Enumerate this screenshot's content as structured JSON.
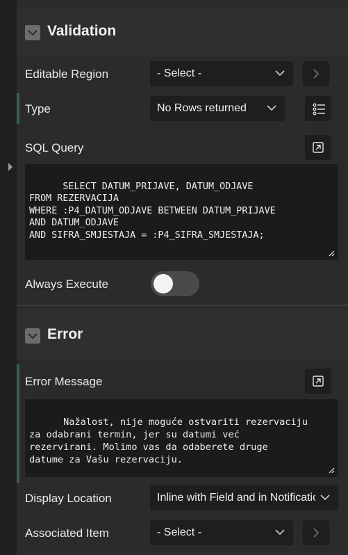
{
  "validation": {
    "title": "Validation",
    "editable_region": {
      "label": "Editable Region",
      "value": "- Select -"
    },
    "type": {
      "label": "Type",
      "value": "No Rows returned"
    },
    "sql_query": {
      "label": "SQL Query",
      "code": "SELECT DATUM_PRIJAVE, DATUM_ODJAVE\nFROM REZERVACIJA\nWHERE :P4_DATUM_ODJAVE BETWEEN DATUM_PRIJAVE\nAND DATUM_ODJAVE\nAND SIFRA_SMJESTAJA = :P4_SIFRA_SMJESTAJA;"
    },
    "always_execute": {
      "label": "Always Execute",
      "on": false
    }
  },
  "error": {
    "title": "Error",
    "error_message": {
      "label": "Error Message",
      "text": "Nažalost, nije moguće ostvariti rezervaciju\nza odabrani termin, jer su datumi već\nrezervirani. Molimo vas da odaberete druge\ndatume za Vašu rezervaciju."
    },
    "display_location": {
      "label": "Display Location",
      "value": "Inline with Field and in Notification"
    },
    "associated_item": {
      "label": "Associated Item",
      "value": "- Select -"
    }
  },
  "icons": {
    "section_toggle": "chevron-down-icon",
    "select_arrow": "chevron-down-icon",
    "go": "chevron-right-icon",
    "list": "list-icon",
    "expand": "expand-icon"
  }
}
